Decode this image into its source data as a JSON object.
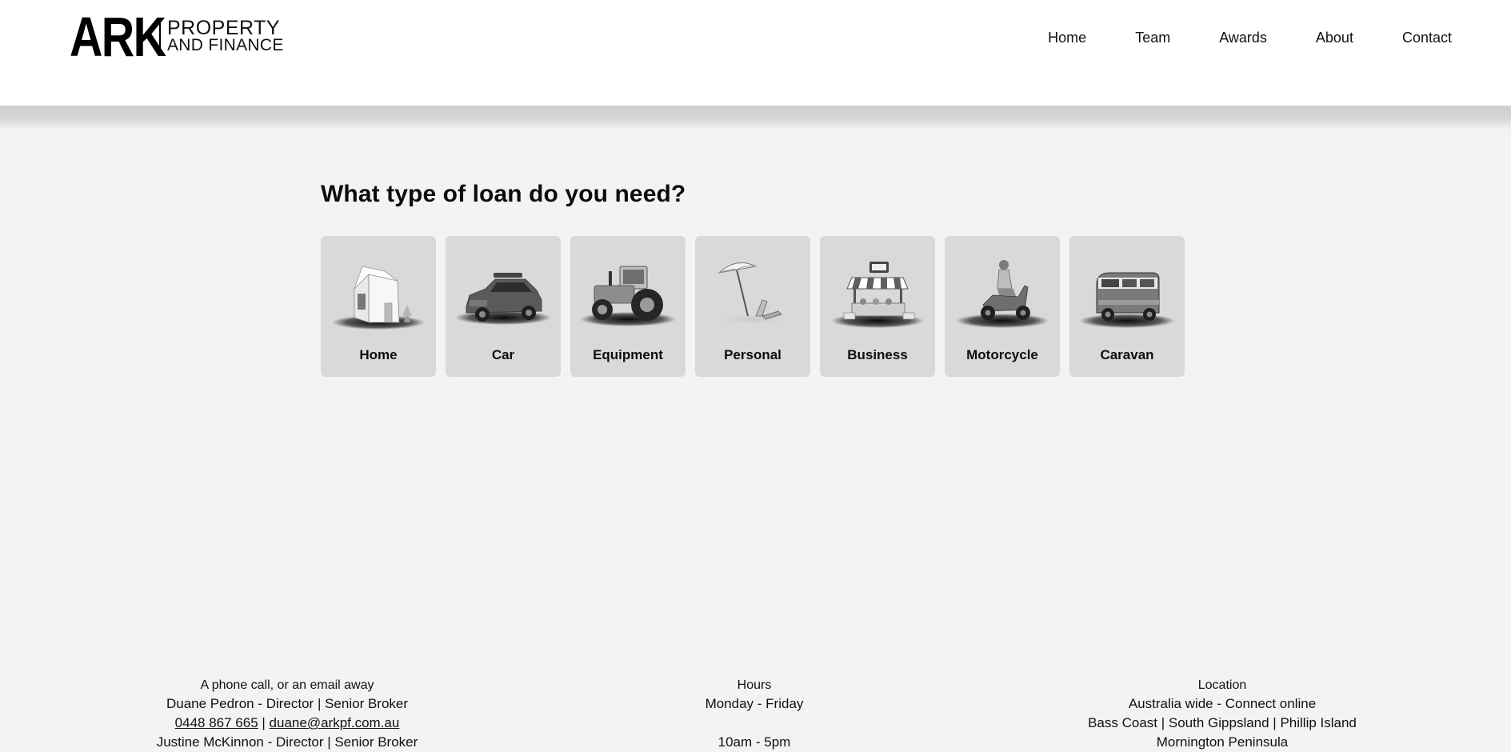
{
  "header": {
    "logo": {
      "mark": "ARK",
      "line1": "PROPERTY",
      "line2": "AND FINANCE"
    },
    "nav": [
      {
        "label": "Home"
      },
      {
        "label": "Team"
      },
      {
        "label": "Awards"
      },
      {
        "label": "About"
      },
      {
        "label": "Contact"
      }
    ]
  },
  "main": {
    "heading": "What type of loan do you need?",
    "cards": [
      {
        "label": "Home",
        "icon": "house-icon"
      },
      {
        "label": "Car",
        "icon": "car-icon"
      },
      {
        "label": "Equipment",
        "icon": "tractor-icon"
      },
      {
        "label": "Personal",
        "icon": "beach-umbrella-icon"
      },
      {
        "label": "Business",
        "icon": "market-stall-icon"
      },
      {
        "label": "Motorcycle",
        "icon": "scooter-icon"
      },
      {
        "label": "Caravan",
        "icon": "campervan-icon"
      }
    ]
  },
  "footer": {
    "contact": {
      "title": "A phone call, or an email away",
      "person1": "Duane Pedron - Director | Senior Broker",
      "phone1": "0448 867 665",
      "separator": "|",
      "email1": "duane@arkpf.com.au",
      "person2": "Justine McKinnon - Director | Senior Broker"
    },
    "hours": {
      "title": "Hours",
      "days": "Monday - Friday",
      "time": "10am - 5pm"
    },
    "location": {
      "title": "Location",
      "line1": "Australia wide - Connect online",
      "line2": "Bass Coast | South Gippsland | Phillip Island",
      "line3": "Mornington Peninsula"
    }
  },
  "colors": {
    "page_background": "#f3f3f3",
    "header_background": "#ffffff",
    "card_background": "#d9d9d9",
    "text": "#111111"
  }
}
